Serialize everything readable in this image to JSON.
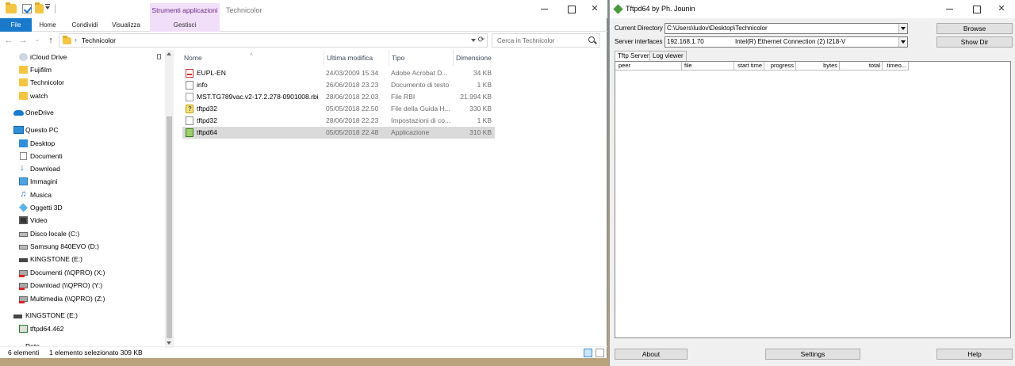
{
  "explorer": {
    "title": "Technicolor",
    "context_header": "Strumenti applicazioni",
    "ribbon_tabs": [
      "File",
      "Home",
      "Condividi",
      "Visualizza",
      "Gestisci"
    ],
    "address": {
      "path": "Technicolor"
    },
    "search": {
      "placeholder": "Cerca in Technicolor"
    },
    "nav": [
      {
        "label": "iCloud Drive",
        "icon": "icloud-icon"
      },
      {
        "label": "Fujifilm",
        "icon": "folder-icon"
      },
      {
        "label": "Technicolor",
        "icon": "folder-icon"
      },
      {
        "label": "watch",
        "icon": "folder-icon"
      },
      {
        "label": "OneDrive",
        "icon": "onedrive-icon"
      },
      {
        "label": "Questo PC",
        "icon": "pc-icon"
      },
      {
        "label": "Desktop",
        "icon": "desktop-icon"
      },
      {
        "label": "Documenti",
        "icon": "documents-icon"
      },
      {
        "label": "Download",
        "icon": "download-icon"
      },
      {
        "label": "Immagini",
        "icon": "images-icon"
      },
      {
        "label": "Musica",
        "icon": "music-icon"
      },
      {
        "label": "Oggetti 3D",
        "icon": "3d-objects-icon"
      },
      {
        "label": "Video",
        "icon": "video-icon"
      },
      {
        "label": "Disco locale (C:)",
        "icon": "drive-icon"
      },
      {
        "label": "Samsung 840EVO (D:)",
        "icon": "drive-icon"
      },
      {
        "label": "KINGSTONE (E:)",
        "icon": "usb-drive-icon"
      },
      {
        "label": "Documenti (\\\\QPRO) (X:)",
        "icon": "network-drive-icon"
      },
      {
        "label": "Download (\\\\QPRO) (Y:)",
        "icon": "network-drive-icon"
      },
      {
        "label": "Multimedia (\\\\QPRO) (Z:)",
        "icon": "network-drive-icon"
      },
      {
        "label": "KINGSTONE (E:)",
        "icon": "usb-drive-icon"
      },
      {
        "label": "tftpd64.462",
        "icon": "app-icon"
      },
      {
        "label": "Rete",
        "icon": "network-icon"
      }
    ],
    "columns": [
      "Nome",
      "Ultima modifica",
      "Tipo",
      "Dimensione"
    ],
    "files": [
      {
        "name": "EUPL-EN",
        "date": "24/03/2009 15.34",
        "type": "Adobe Acrobat D...",
        "size": "34 KB",
        "icon": "pdf-icon"
      },
      {
        "name": "info",
        "date": "26/06/2018 23.23",
        "type": "Documento di testo",
        "size": "1 KB",
        "icon": "text-file-icon"
      },
      {
        "name": "MST.TG789vac.v2-17.2.278-0901008.rbi",
        "date": "28/06/2018 22.03",
        "type": "File RBI",
        "size": "21.994 KB",
        "icon": "file-icon"
      },
      {
        "name": "tftpd32",
        "date": "05/05/2018 22.50",
        "type": "File della Guida H...",
        "size": "330 KB",
        "icon": "help-file-icon"
      },
      {
        "name": "tftpd32",
        "date": "28/06/2018 22.23",
        "type": "Impostazioni di co...",
        "size": "1 KB",
        "icon": "settings-file-icon"
      },
      {
        "name": "tftpd64",
        "date": "05/05/2018 22.48",
        "type": "Applicazione",
        "size": "310 KB",
        "icon": "app-icon"
      }
    ],
    "status": {
      "count": "6 elementi",
      "selection": "1 elemento selezionato  309 KB"
    }
  },
  "tftpd": {
    "title": "Tftpd64 by Ph. Jounin",
    "current_directory_label": "Current Directory",
    "current_directory_value": "C:\\Users\\ludov\\Desktop\\Technicolor",
    "server_interfaces_label": "Server interfaces",
    "server_ip": "192.168.1.70",
    "server_adapter": "Intel(R) Ethernet Connection (2) I218-V",
    "browse_button": "Browse",
    "showdir_button": "Show Dir",
    "tabs": [
      "Tftp Server",
      "Log viewer"
    ],
    "columns": [
      "peer",
      "file",
      "start time",
      "progress",
      "bytes",
      "total",
      "timeo..."
    ],
    "about_button": "About",
    "settings_button": "Settings",
    "help_button": "Help"
  }
}
